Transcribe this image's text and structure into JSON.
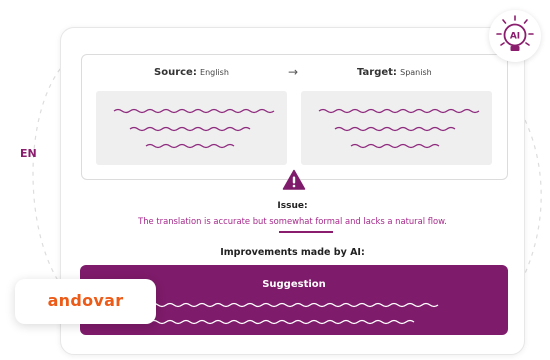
{
  "language_badge": "EN",
  "panel": {
    "source_key": "Source:",
    "source_value": "English",
    "arrow": "→",
    "target_key": "Target:",
    "target_value": "Spanish"
  },
  "issue": {
    "title": "Issue:",
    "text": "The translation is accurate but somewhat formal and lacks a natural flow."
  },
  "improvements_title": "Improvements made by AI:",
  "suggestion": {
    "title": "Suggestion"
  },
  "logo": {
    "text": "andovar"
  },
  "ai_badge": {
    "label": "AI"
  },
  "colors": {
    "brand_purple": "#7e1b6a",
    "issue_text": "#a62a8c",
    "logo_orange": "#ec5b18"
  },
  "icons": [
    "warning-icon",
    "ai-lightbulb-icon"
  ]
}
